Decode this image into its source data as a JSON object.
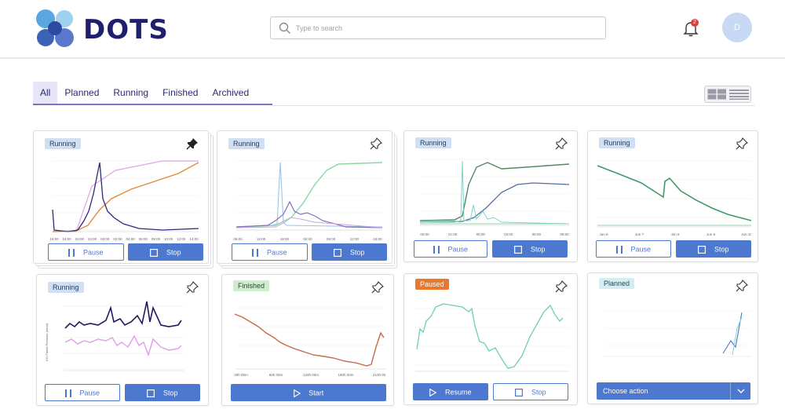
{
  "header": {
    "logo_text": "DOTS",
    "search_placeholder": "Type to search",
    "notification_count": "2",
    "avatar_initial": "D"
  },
  "tabs": [
    {
      "label": "All",
      "active": true
    },
    {
      "label": "Planned",
      "active": false
    },
    {
      "label": "Running",
      "active": false
    },
    {
      "label": "Finished",
      "active": false
    },
    {
      "label": "Archived",
      "active": false
    }
  ],
  "colors": {
    "brand_navy": "#1f1f6e",
    "accent_blue": "#4c78cf",
    "badge_running": "#cfe0f5",
    "badge_finished": "#cfeccf",
    "badge_paused": "#e9772d",
    "badge_planned": "#d3eef2"
  },
  "cards": [
    {
      "status": "Running",
      "pinned": true,
      "stacked": true,
      "actions": [
        "Pause",
        "Stop"
      ],
      "x_ticks": [
        "16:00",
        "18:00",
        "20:00",
        "22:00",
        "00:00",
        "02:00",
        "04:00",
        "06:00",
        "08:00",
        "10:00",
        "12:00",
        "14:00"
      ]
    },
    {
      "status": "Running",
      "pinned": false,
      "stacked": true,
      "actions": [
        "Pause",
        "Stop"
      ],
      "x_ticks": [
        "06:00",
        "12:00",
        "18:00",
        "00:00",
        "06:00",
        "12:00",
        "18:00"
      ]
    },
    {
      "status": "Running",
      "pinned": false,
      "stacked": false,
      "actions": [
        "Pause",
        "Stop"
      ],
      "x_ticks": [
        "00:00",
        "21:00",
        "00:00",
        "03:00",
        "06:00",
        "09:00"
      ]
    },
    {
      "status": "Running",
      "pinned": false,
      "stacked": false,
      "actions": [
        "Pause",
        "Stop"
      ],
      "x_ticks": [
        "Jun 6",
        "Jun 7",
        "Jun 8",
        "Jun 9",
        "Jun 10"
      ]
    },
    {
      "status": "Running",
      "pinned": false,
      "stacked": false,
      "actions": [
        "Pause",
        "Stop"
      ],
      "y_label": "DO Partial Pressure (mbar)"
    },
    {
      "status": "Finished",
      "pinned": false,
      "stacked": false,
      "actions": [
        "Start"
      ],
      "x_ticks": [
        "30h 00m",
        "60h 00m",
        "120h 00m",
        "180h 00m",
        "210h 00m"
      ]
    },
    {
      "status": "Paused",
      "pinned": false,
      "stacked": false,
      "actions": [
        "Resume",
        "Stop"
      ]
    },
    {
      "status": "Planned",
      "pinned": false,
      "stacked": false,
      "actions": [],
      "select_label": "Choose action"
    }
  ]
}
